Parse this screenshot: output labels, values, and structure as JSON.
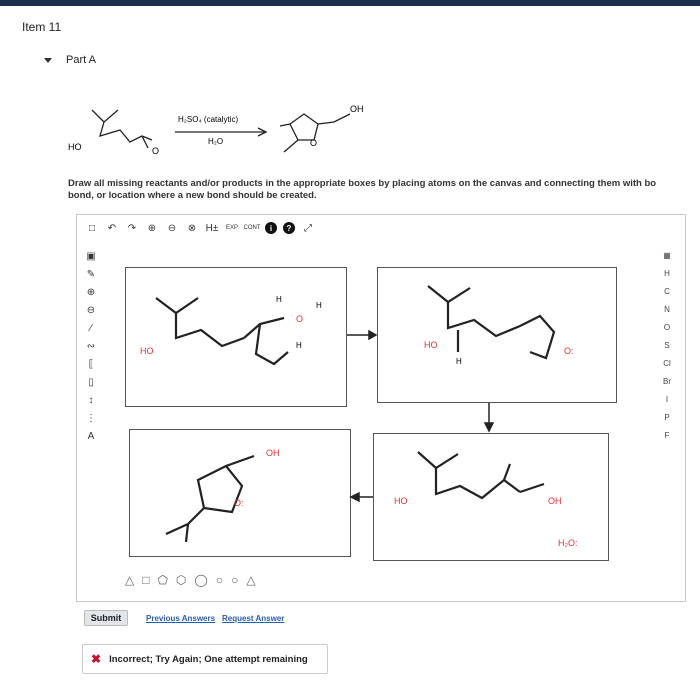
{
  "item": {
    "title": "Item 11"
  },
  "part": {
    "label": "Part A"
  },
  "reaction": {
    "reactant_label": "HO",
    "reactant_o": "O",
    "reagent_top": "H₂SO₄ (catalytic)",
    "reagent_bottom": "H₂O",
    "product_oh": "OH",
    "product_o": "O"
  },
  "instructions": {
    "line1": "Draw all missing reactants and/or products in the appropriate boxes by placing atoms on the canvas and connecting them with bo",
    "line2": "bond, or location where a new bond should be created."
  },
  "toolbar": {
    "h_label": "H±",
    "exp_label": "EXP",
    "cont_label": "CONT"
  },
  "periodic": [
    "H",
    "C",
    "N",
    "O",
    "S",
    "Cl",
    "Br",
    "I",
    "P",
    "F"
  ],
  "lefttools": {
    "a_label": "A"
  },
  "boxes": {
    "b1": {
      "ho": "HO",
      "h1": "H",
      "h2": "H",
      "o": "O",
      "h3": "H"
    },
    "b2": {
      "ho": "HO",
      "h": "H",
      "o": "O:"
    },
    "b3": {
      "oh": "OH",
      "o": "O:"
    },
    "b4": {
      "ho": "HO",
      "oh": "OH",
      "water": "H₂O:"
    }
  },
  "actions": {
    "submit": "Submit",
    "previous": "Previous Answers",
    "request": "Request Answer"
  },
  "feedback": {
    "message": "Incorrect; Try Again; One attempt remaining"
  }
}
